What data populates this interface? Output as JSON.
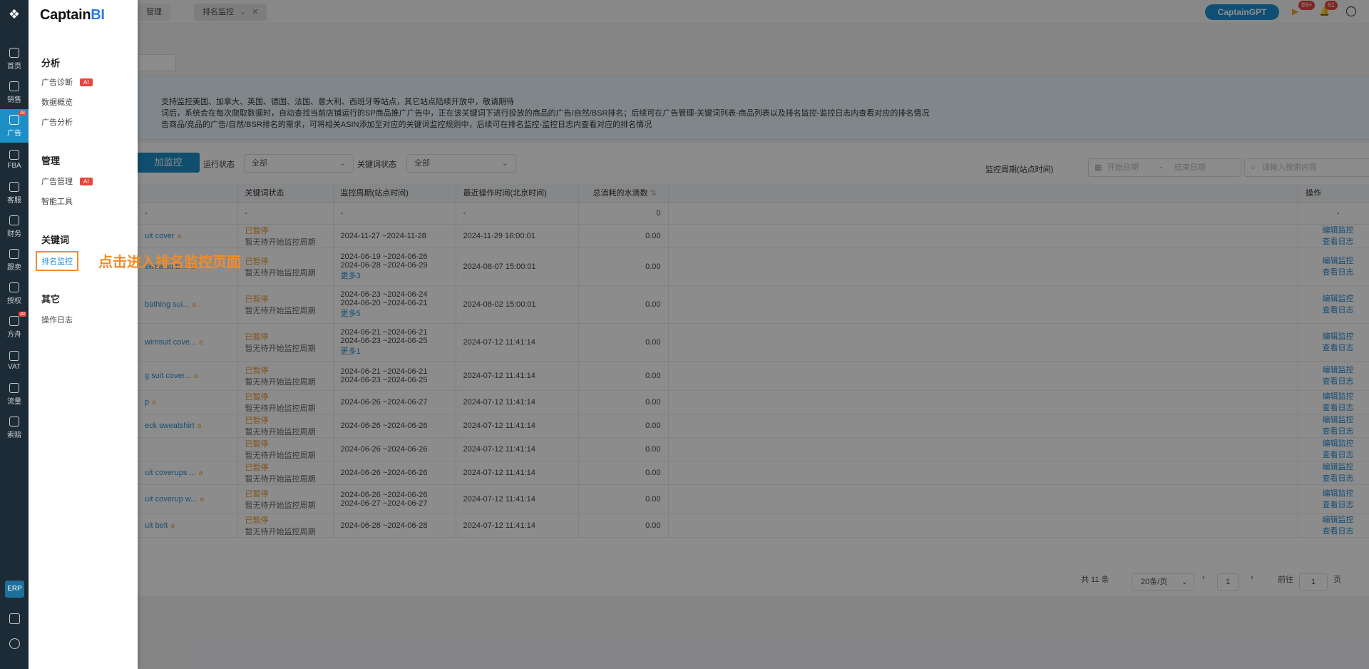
{
  "rail": {
    "items": [
      {
        "label": "首页",
        "icon": "home-icon"
      },
      {
        "label": "销售",
        "icon": "sales-chart-icon"
      },
      {
        "label": "广告",
        "icon": "ad-icon",
        "active": true,
        "badge": "AI"
      },
      {
        "label": "FBA",
        "icon": "fba-box-icon"
      },
      {
        "label": "客服",
        "icon": "customer-service-icon"
      },
      {
        "label": "财务",
        "icon": "finance-icon"
      },
      {
        "label": "跟卖",
        "icon": "follow-sell-icon"
      },
      {
        "label": "授权",
        "icon": "shield-icon"
      },
      {
        "label": "方舟",
        "icon": "ark-icon",
        "badge": "AI"
      },
      {
        "label": "VAT",
        "icon": "vat-building-icon"
      },
      {
        "label": "流量",
        "icon": "traffic-icon"
      },
      {
        "label": "索赔",
        "icon": "claim-icon"
      }
    ],
    "erp": "ERP"
  },
  "flyout": {
    "brand_main": "Captain",
    "brand_accent": "BI",
    "groups": [
      {
        "title": "分析",
        "items": [
          {
            "label": "广告诊断",
            "ai": "AI"
          },
          {
            "label": "数据概览"
          },
          {
            "label": "广告分析"
          }
        ]
      },
      {
        "title": "管理",
        "items": [
          {
            "label": "广告管理",
            "ai": "AI"
          },
          {
            "label": "智能工具"
          }
        ]
      },
      {
        "title": "关键词",
        "items": [
          {
            "label": "排名监控"
          }
        ]
      },
      {
        "title": "其它",
        "items": [
          {
            "label": "操作日志"
          }
        ]
      }
    ],
    "callout": "点击进入排名监控页面"
  },
  "tabs": [
    {
      "label": "管理"
    },
    {
      "label": "排名监控"
    }
  ],
  "topbar": {
    "gpt": "CaptainGPT",
    "flag_badge": "99+",
    "bell_badge": "61"
  },
  "notice": {
    "line1": "支持监控美国、加拿大、英国、德国、法国、意大利、西班牙等站点，其它站点陆续开放中，敬请期待",
    "line2": "词后，系统会在每次爬取数据时，自动查找当前店铺运行的SP商品推广广告中，正在该关键词下进行投放的商品的广告/自然/BSR排名；后续可在广告管理-关键词列表-商品列表以及排名监控-监控日志内查看对应的排名情况",
    "line3": "告商品/竞品的广告/自然/BSR排名的需求，可将相关ASIN添加至对应的关键词监控规则中，后续可在排名监控-监控日志内查看对应的排名情况"
  },
  "toolbar": {
    "add_btn": "加监控",
    "run_status_label": "运行状态",
    "run_status_value": "全部",
    "kw_status_label": "关键词状态",
    "kw_status_value": "全部",
    "period_label": "监控周期(站点时间)",
    "start_placeholder": "开始日期",
    "range_sep": "-",
    "end_placeholder": "结束日期",
    "search_placeholder": "请输入搜索内容"
  },
  "table": {
    "headers": {
      "kw_status": "关键词状态",
      "period": "监控周期(站点时间)",
      "last_op": "最近操作时间(北京时间)",
      "consumed": "总消耗的水滴数",
      "op": "操作"
    },
    "summary": {
      "kw": "-",
      "status": "-",
      "period": "-",
      "last_op": "-",
      "consumed": "0",
      "op": "-"
    },
    "rows": [
      {
        "kw": "uit cover",
        "status": "已暂停",
        "sub": "暂无待开始监控周期",
        "periods": [
          "2024-11-27 ~2024-11-28"
        ],
        "more": "",
        "last_op": "2024-11-29 16:00:01",
        "consumed": "0.00"
      },
      {
        "kw": "sweatsuits...",
        "status": "已暂停",
        "sub": "暂无待开始监控周期",
        "periods": [
          "2024-06-19 ~2024-06-26",
          "2024-06-28 ~2024-06-29"
        ],
        "more": "更多3",
        "last_op": "2024-08-07 15:00:01",
        "consumed": "0.00"
      },
      {
        "kw": "bathing sui...",
        "status": "已暂停",
        "sub": "暂无待开始监控周期",
        "periods": [
          "2024-06-23 ~2024-06-24",
          "2024-06-20 ~2024-06-21"
        ],
        "more": "更多5",
        "last_op": "2024-08-02 15:00:01",
        "consumed": "0.00"
      },
      {
        "kw": "wimsuit cove...",
        "status": "已暂停",
        "sub": "暂无待开始监控周期",
        "periods": [
          "2024-06-21 ~2024-06-21",
          "2024-06-23 ~2024-06-25"
        ],
        "more": "更多1",
        "last_op": "2024-07-12 11:41:14",
        "consumed": "0.00"
      },
      {
        "kw": "g suit cover...",
        "status": "已暂停",
        "sub": "暂无待开始监控周期",
        "periods": [
          "2024-06-21 ~2024-06-21",
          "2024-06-23 ~2024-06-25"
        ],
        "more": "",
        "last_op": "2024-07-12 11:41:14",
        "consumed": "0.00"
      },
      {
        "kw": "p",
        "status": "已暂停",
        "sub": "暂无待开始监控周期",
        "periods": [
          "2024-06-26 ~2024-06-27"
        ],
        "more": "",
        "last_op": "2024-07-12 11:41:14",
        "consumed": "0.00"
      },
      {
        "kw": "eck sweatshirt",
        "status": "已暂停",
        "sub": "暂无待开始监控周期",
        "periods": [
          "2024-06-26 ~2024-06-26"
        ],
        "more": "",
        "last_op": "2024-07-12 11:41:14",
        "consumed": "0.00"
      },
      {
        "kw": "",
        "status": "已暂停",
        "sub": "暂无待开始监控周期",
        "periods": [
          "2024-06-26 ~2024-06-26"
        ],
        "more": "",
        "last_op": "2024-07-12 11:41:14",
        "consumed": "0.00"
      },
      {
        "kw": "uit coverups ...",
        "status": "已暂停",
        "sub": "暂无待开始监控周期",
        "periods": [
          "2024-06-26 ~2024-06-26"
        ],
        "more": "",
        "last_op": "2024-07-12 11:41:14",
        "consumed": "0.00"
      },
      {
        "kw": "uit coverup w...",
        "status": "已暂停",
        "sub": "暂无待开始监控周期",
        "periods": [
          "2024-06-26 ~2024-06-26",
          "2024-06-27 ~2024-06-27"
        ],
        "more": "",
        "last_op": "2024-07-12 11:41:14",
        "consumed": "0.00"
      },
      {
        "kw": "uit belt",
        "status": "已暂停",
        "sub": "暂无待开始监控周期",
        "periods": [
          "2024-06-28 ~2024-06-28"
        ],
        "more": "",
        "last_op": "2024-07-12 11:41:14",
        "consumed": "0.00"
      }
    ],
    "op_edit": "编辑监控",
    "op_log": "查看日志"
  },
  "pager": {
    "total": "共 11 条",
    "page_size": "20条/页",
    "current": "1",
    "goto_label": "前往",
    "goto_value": "1",
    "page_unit": "页"
  }
}
